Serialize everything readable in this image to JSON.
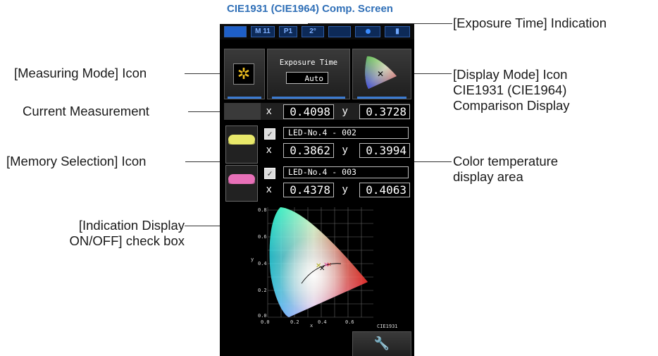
{
  "title": "CIE1931 (CIE1964) Comp. Screen",
  "status_bar": {
    "mode": "M 11",
    "program": "P1",
    "observer": "2°"
  },
  "measuring_mode_icon": "sun-icon",
  "exposure": {
    "label": "Exposure Time",
    "value": "Auto"
  },
  "display_mode_icon": "cie-diagram-icon",
  "current": {
    "x_label": "x",
    "x": "0.4098",
    "y_label": "y",
    "y": "0.3728"
  },
  "memories": [
    {
      "name": "LED-No.4 - 002",
      "checked": "✓",
      "x_label": "x",
      "x": "0.3862",
      "y_label": "y",
      "y": "0.3994",
      "color": "#e8e86a"
    },
    {
      "name": "LED-No.4 - 003",
      "checked": "✓",
      "x_label": "x",
      "x": "0.4378",
      "y_label": "y",
      "y": "0.4063",
      "color": "#e870b8"
    }
  ],
  "chart": {
    "y_axis_label": "y",
    "x_axis_label": "x",
    "y_ticks": [
      "0.8",
      "0.6",
      "0.4",
      "0.2",
      "0.0"
    ],
    "x_ticks": [
      "0.0",
      "0.2",
      "0.4",
      "0.6"
    ],
    "caption": "CIE1931"
  },
  "settings_icon": "wrench-icon",
  "callouts": {
    "measuring_mode": "[Measuring Mode] Icon",
    "current_measurement": "Current Measurement",
    "memory_selection": "[Memory Selection] Icon",
    "indication_display_1": "[Indication Display",
    "indication_display_2": "ON/OFF] check box",
    "exposure_time": "[Exposure Time] Indication",
    "display_mode_1": "[Display Mode] Icon",
    "display_mode_2": "CIE1931 (CIE1964)",
    "display_mode_3": "Comparison Display",
    "color_temp_1": "Color temperature",
    "color_temp_2": "display area"
  }
}
